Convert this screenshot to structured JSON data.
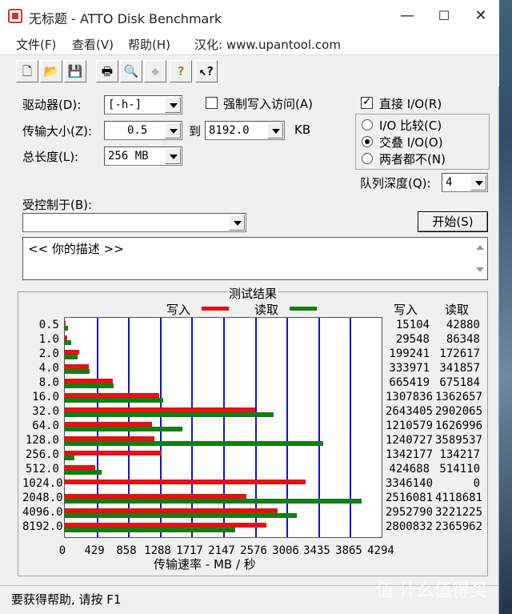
{
  "window": {
    "title": "无标题 - ATTO Disk Benchmark"
  },
  "menu": [
    "文件(F)",
    "查看(V)",
    "帮助(H)",
    "汉化: www.upantool.com"
  ],
  "toolbar_icons": [
    "new-file-icon",
    "open-folder-icon",
    "save-icon",
    "print-icon",
    "print-preview-icon",
    "move-icon",
    "help-icon",
    "context-help-icon"
  ],
  "controls": {
    "drive_label": "驱动器(D):",
    "drive_value": "[-h-]",
    "transfer_label": "传输大小(Z):",
    "transfer_from": "0.5",
    "to_label": "到",
    "transfer_to": "8192.0",
    "unit": "KB",
    "length_label": "总长度(L):",
    "length_value": "256 MB",
    "force_write_label": "强制写入访问(A)",
    "direct_io_label": "直接 I/O(R)",
    "io_compare_label": "I/O 比较(C)",
    "overlap_io_label": "交叠 I/O(O)",
    "neither_label": "两者都不(N)",
    "queue_label": "队列深度(Q):",
    "queue_value": "4",
    "controlled_label": "受控制于(B):",
    "controlled_value": "",
    "start_label": "开始(S)",
    "description": "<<  你的描述  >>"
  },
  "results": {
    "title": "测试结果",
    "write_legend": "写入",
    "read_legend": "读取",
    "col_write": "写入",
    "col_read": "读取",
    "xlabel": "传输速率 - MB / 秒"
  },
  "chart_data": {
    "type": "bar",
    "orientation": "horizontal",
    "title": "测试结果",
    "xlabel": "传输速率 - MB / 秒",
    "xlim": [
      0,
      4294
    ],
    "x_ticks": [
      "0",
      "429",
      "858",
      "1288",
      "1717",
      "2147",
      "2576",
      "3006",
      "3435",
      "3865",
      "4294"
    ],
    "categories": [
      "0.5",
      "1.0",
      "2.0",
      "4.0",
      "8.0",
      "16.0",
      "32.0",
      "64.0",
      "128.0",
      "256.0",
      "512.0",
      "1024.0",
      "2048.0",
      "4096.0",
      "8192.0"
    ],
    "series": [
      {
        "name": "写入",
        "color": "#e81010",
        "values": [
          15104,
          29548,
          199241,
          333971,
          665419,
          1307836,
          2643405,
          1210579,
          1240727,
          1342177,
          424688,
          3346140,
          2516081,
          2952790,
          2800832
        ]
      },
      {
        "name": "读取",
        "color": "#108010",
        "values": [
          42880,
          86348,
          172617,
          341857,
          675184,
          1362657,
          2902065,
          1626996,
          3589537,
          134217,
          514110,
          0,
          4118681,
          3221225,
          2365962
        ]
      }
    ],
    "grid": true
  },
  "status": {
    "text": "要获得帮助, 请按 F1"
  },
  "watermark": "值 什么值得买"
}
